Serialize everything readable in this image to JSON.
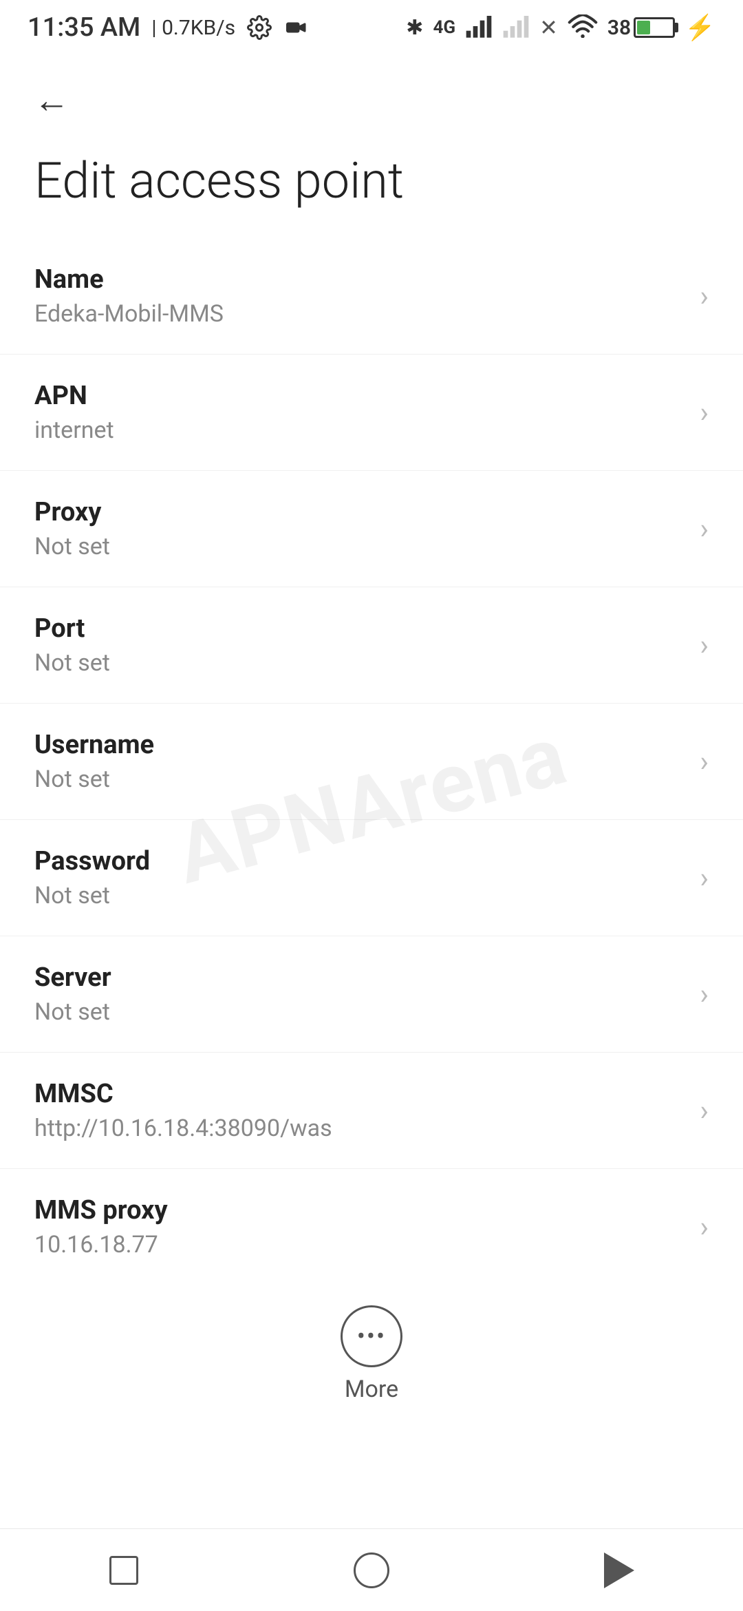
{
  "statusBar": {
    "time": "11:35 AM",
    "speed": "0.7KB/s"
  },
  "header": {
    "back_label": "←",
    "title": "Edit access point"
  },
  "settings": {
    "items": [
      {
        "label": "Name",
        "value": "Edeka-Mobil-MMS"
      },
      {
        "label": "APN",
        "value": "internet"
      },
      {
        "label": "Proxy",
        "value": "Not set"
      },
      {
        "label": "Port",
        "value": "Not set"
      },
      {
        "label": "Username",
        "value": "Not set"
      },
      {
        "label": "Password",
        "value": "Not set"
      },
      {
        "label": "Server",
        "value": "Not set"
      },
      {
        "label": "MMSC",
        "value": "http://10.16.18.4:38090/was"
      },
      {
        "label": "MMS proxy",
        "value": "10.16.18.77"
      }
    ]
  },
  "more": {
    "label": "More"
  },
  "navbar": {
    "recent_label": "recent",
    "home_label": "home",
    "back_label": "back"
  },
  "watermark": "APNArena"
}
